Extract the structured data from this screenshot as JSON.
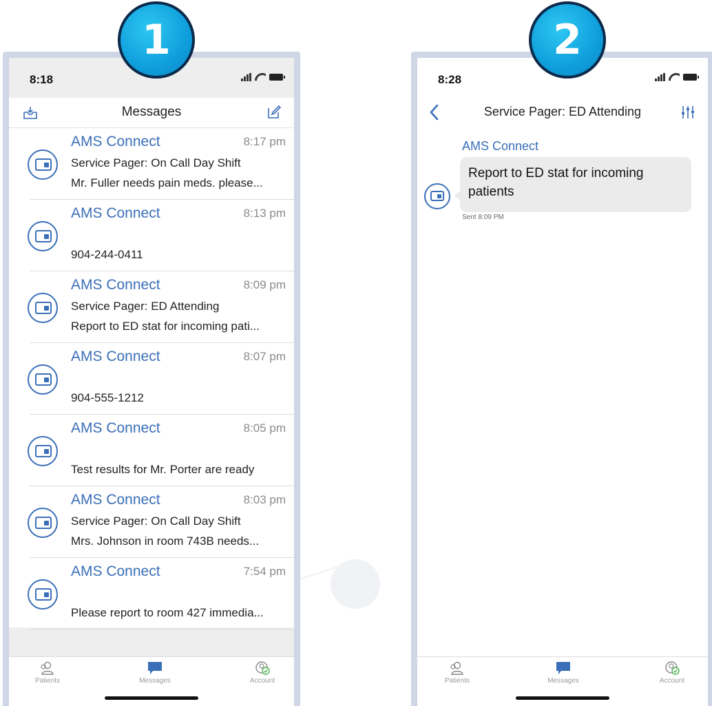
{
  "badges": {
    "first": "1",
    "second": "2"
  },
  "phone1": {
    "status_time": "8:18",
    "title": "Messages",
    "messages": [
      {
        "sender": "AMS Connect",
        "time": "8:17 pm",
        "line1": "Service Pager: On Call Day Shift",
        "line2": "Mr. Fuller needs pain meds. please..."
      },
      {
        "sender": "AMS Connect",
        "time": "8:13 pm",
        "line1": "",
        "line2": "904-244-0411"
      },
      {
        "sender": "AMS Connect",
        "time": "8:09 pm",
        "line1": "Service Pager: ED Attending",
        "line2": "Report to ED stat for incoming pati..."
      },
      {
        "sender": "AMS Connect",
        "time": "8:07 pm",
        "line1": "",
        "line2": "904-555-1212"
      },
      {
        "sender": "AMS Connect",
        "time": "8:05 pm",
        "line1": "",
        "line2": "Test results for Mr. Porter are ready"
      },
      {
        "sender": "AMS Connect",
        "time": "8:03 pm",
        "line1": "Service Pager: On Call Day Shift",
        "line2": "Mrs. Johnson in room 743B needs..."
      },
      {
        "sender": "AMS Connect",
        "time": "7:54 pm",
        "line1": "",
        "line2": "Please report to room 427 immedia..."
      }
    ]
  },
  "phone2": {
    "status_time": "8:28",
    "title": "Service Pager: ED Attending",
    "chat": {
      "sender": "AMS Connect",
      "body": "Report to ED stat for incoming patients",
      "sent": "Sent 8:09 PM"
    }
  },
  "tabs": {
    "patients": "Patients",
    "messages": "Messages",
    "account": "Account"
  },
  "colors": {
    "accent": "#3a6fb8",
    "badge": "#0f9fdc",
    "frame": "#cfd6e6",
    "bubble": "#ebebeb"
  },
  "icons": [
    "inbox-download-icon",
    "compose-icon",
    "back-chevron-icon",
    "sliders-icon",
    "pager-avatar-icon",
    "patients-icon",
    "messages-icon",
    "account-icon"
  ]
}
